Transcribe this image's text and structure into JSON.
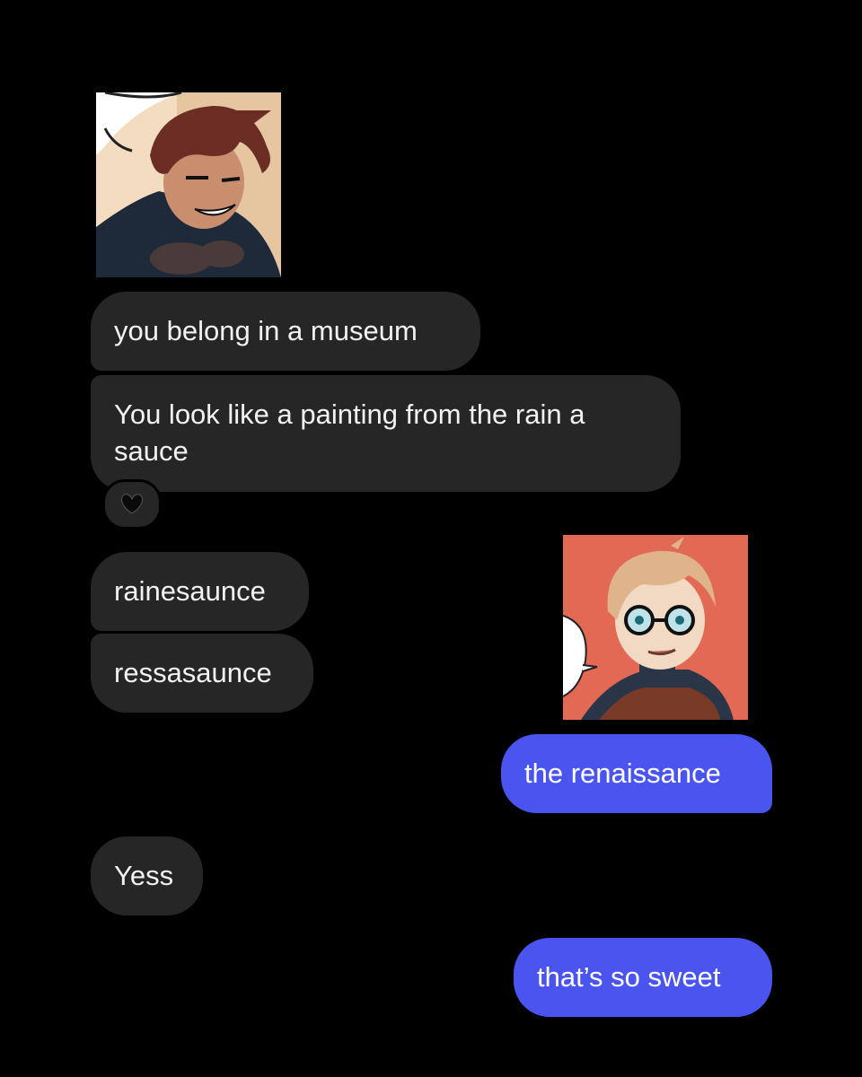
{
  "messages": {
    "m1": "you belong in a museum",
    "m2": "You look like a painting from the rain a sauce",
    "m3": "rainesaunce",
    "m4": "ressasaunce",
    "m5": "the renaissance",
    "m6": "Yess",
    "m7": "that’s so sweet"
  },
  "reaction": {
    "icon": "black-heart-icon"
  },
  "colors": {
    "background": "#000000",
    "received_bubble": "#262626",
    "sent_bubble": "#4a55f0"
  }
}
